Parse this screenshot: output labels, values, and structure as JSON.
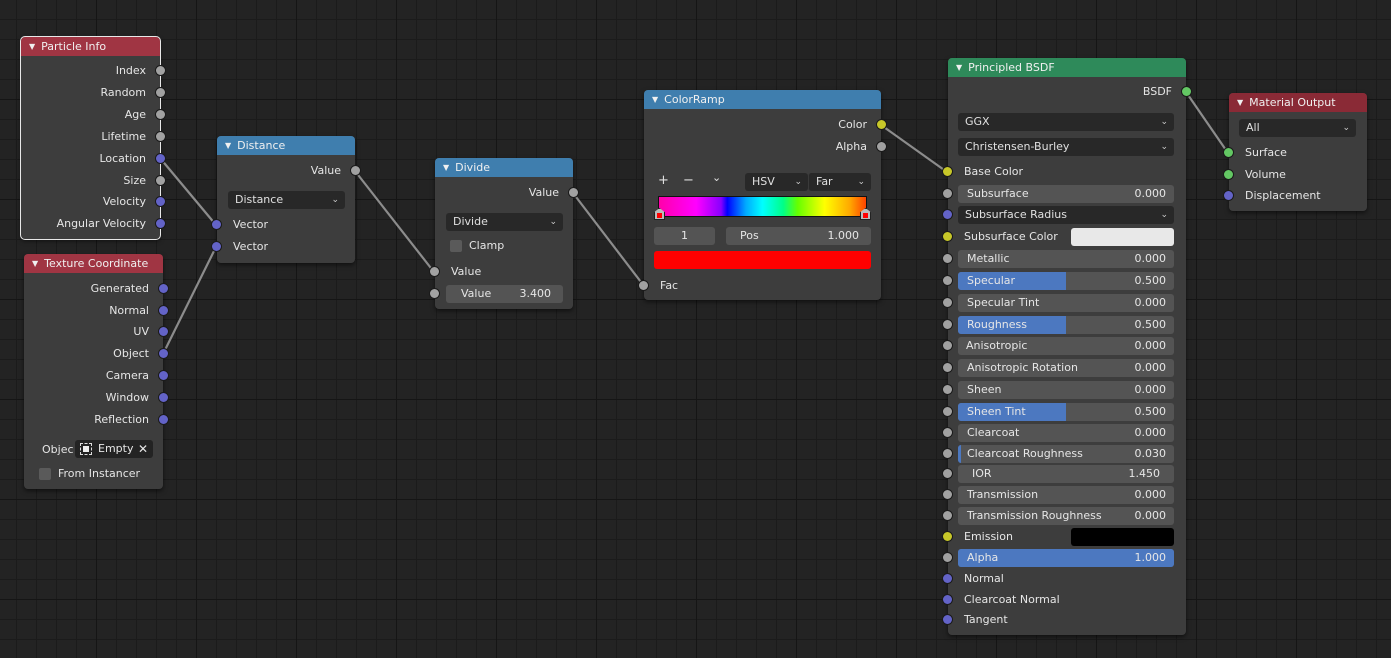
{
  "nodes": {
    "particle_info": {
      "title": "Particle Info",
      "outputs": [
        "Index",
        "Random",
        "Age",
        "Lifetime",
        "Location",
        "Size",
        "Velocity",
        "Angular Velocity"
      ]
    },
    "texture_coordinate": {
      "title": "Texture Coordinate",
      "outputs": [
        "Generated",
        "Normal",
        "UV",
        "Object",
        "Camera",
        "Window",
        "Reflection"
      ],
      "object_label": "Objec",
      "object_value": "Empty",
      "from_instancer_label": "From Instancer",
      "from_instancer_checked": false
    },
    "distance": {
      "title": "Distance",
      "output": "Value",
      "operation": "Distance",
      "inputs": [
        "Vector",
        "Vector"
      ]
    },
    "divide": {
      "title": "Divide",
      "output": "Value",
      "operation": "Divide",
      "clamp_label": "Clamp",
      "clamp_checked": false,
      "input_label": "Value",
      "value_label": "Value",
      "value": "3.400"
    },
    "color_ramp": {
      "title": "ColorRamp",
      "outputs": [
        "Color",
        "Alpha"
      ],
      "add_label": "+",
      "remove_label": "−",
      "menu_label": "⌄",
      "color_mode": "HSV",
      "interpolation": "Far",
      "active_stop_index": "1",
      "pos_label": "Pos",
      "pos_value": "1.000",
      "active_color": "#ff0000",
      "input": "Fac"
    },
    "principled_bsdf": {
      "title": "Principled BSDF",
      "output": "BSDF",
      "distribution": "GGX",
      "subsurface_method": "Christensen-Burley",
      "base_color_label": "Base Color",
      "subsurface_label": "Subsurface",
      "subsurface": "0.000",
      "subsurface_radius_label": "Subsurface Radius",
      "subsurface_color_label": "Subsurface Color",
      "subsurface_color": "#e8e8e8",
      "metallic_label": "Metallic",
      "metallic": "0.000",
      "metallic_fill": 0.0,
      "specular_label": "Specular",
      "specular": "0.500",
      "specular_fill": 0.5,
      "specular_tint_label": "Specular Tint",
      "specular_tint": "0.000",
      "roughness_label": "Roughness",
      "roughness": "0.500",
      "roughness_fill": 0.5,
      "anisotropic_label": "Anisotropic",
      "anisotropic": "0.000",
      "anisotropic_rotation_label": "Anisotropic Rotation",
      "anisotropic_rotation": "0.000",
      "sheen_label": "Sheen",
      "sheen": "0.000",
      "sheen_tint_label": "Sheen Tint",
      "sheen_tint": "0.500",
      "sheen_tint_fill": 0.5,
      "clearcoat_label": "Clearcoat",
      "clearcoat": "0.000",
      "clearcoat_roughness_label": "Clearcoat Roughness",
      "clearcoat_roughness": "0.030",
      "clearcoat_roughness_fill": 0.03,
      "ior_label": "IOR",
      "ior": "1.450",
      "transmission_label": "Transmission",
      "transmission": "0.000",
      "transmission_roughness_label": "Transmission Roughness",
      "transmission_roughness": "0.000",
      "emission_label": "Emission",
      "emission_color": "#000000",
      "alpha_label": "Alpha",
      "alpha": "1.000",
      "alpha_fill": 1.0,
      "normal_label": "Normal",
      "clearcoat_normal_label": "Clearcoat Normal",
      "tangent_label": "Tangent"
    },
    "material_output": {
      "title": "Material Output",
      "target": "All",
      "inputs": [
        "Surface",
        "Volume",
        "Displacement"
      ]
    }
  },
  "colors": {
    "header_input": "#a03543",
    "header_converter": "#3f7eae",
    "header_shader": "#2e8a5a",
    "socket_float": "#a1a1a1",
    "socket_vector": "#6363c7",
    "socket_color": "#c7c729",
    "socket_shader": "#63c763",
    "slider_fill": "#4c78c0"
  }
}
